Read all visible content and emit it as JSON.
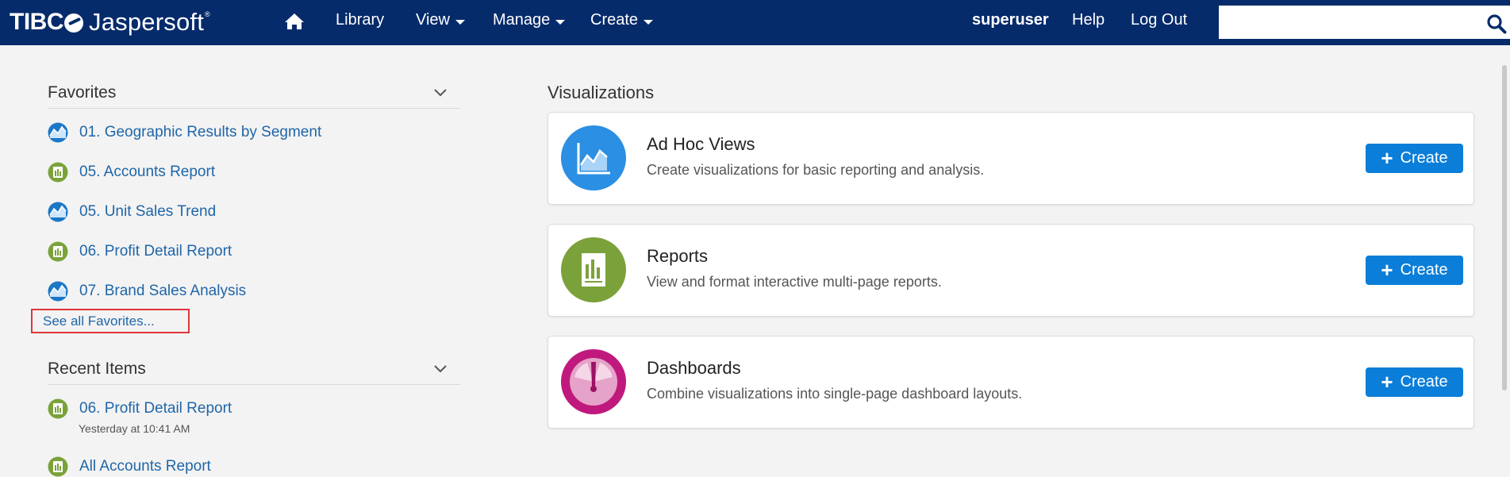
{
  "header": {
    "logo_brand": "TIBC",
    "logo_product": "Jaspersoft",
    "logo_reg": "®",
    "nav": {
      "library": "Library",
      "view": "View",
      "manage": "Manage",
      "create": "Create"
    },
    "user": "superuser",
    "help": "Help",
    "logout": "Log Out",
    "search_value": "",
    "search_placeholder": ""
  },
  "favorites": {
    "title": "Favorites",
    "items": [
      {
        "label": "01. Geographic Results by Segment",
        "icon": "adhoc-view-icon"
      },
      {
        "label": "05. Accounts Report",
        "icon": "report-icon"
      },
      {
        "label": "05. Unit Sales Trend",
        "icon": "adhoc-view-icon"
      },
      {
        "label": "06. Profit Detail Report",
        "icon": "report-icon"
      },
      {
        "label": "07. Brand Sales Analysis",
        "icon": "adhoc-view-icon"
      }
    ],
    "see_all": "See all Favorites..."
  },
  "recent": {
    "title": "Recent Items",
    "items": [
      {
        "label": "06. Profit Detail Report",
        "sub": "Yesterday at 10:41 AM",
        "icon": "report-icon"
      },
      {
        "label": "All Accounts Report",
        "sub": "",
        "icon": "report-icon"
      }
    ]
  },
  "visualizations": {
    "title": "Visualizations",
    "cards": [
      {
        "name": "Ad Hoc Views",
        "desc": "Create visualizations for basic reporting and analysis.",
        "button": "Create",
        "icon": "adhoc-chart-icon",
        "color": "#2b8fe3"
      },
      {
        "name": "Reports",
        "desc": "View and format interactive multi-page reports.",
        "button": "Create",
        "icon": "report-bars-icon",
        "color": "#7ba23a"
      },
      {
        "name": "Dashboards",
        "desc": "Combine visualizations into single-page dashboard layouts.",
        "button": "Create",
        "icon": "dashboard-gauge-icon",
        "color": "#c0197d"
      }
    ]
  },
  "colors": {
    "header_bg": "#062b6b",
    "link": "#1f66a8",
    "button": "#0a7ed9",
    "highlight_border": "#e0353a"
  }
}
